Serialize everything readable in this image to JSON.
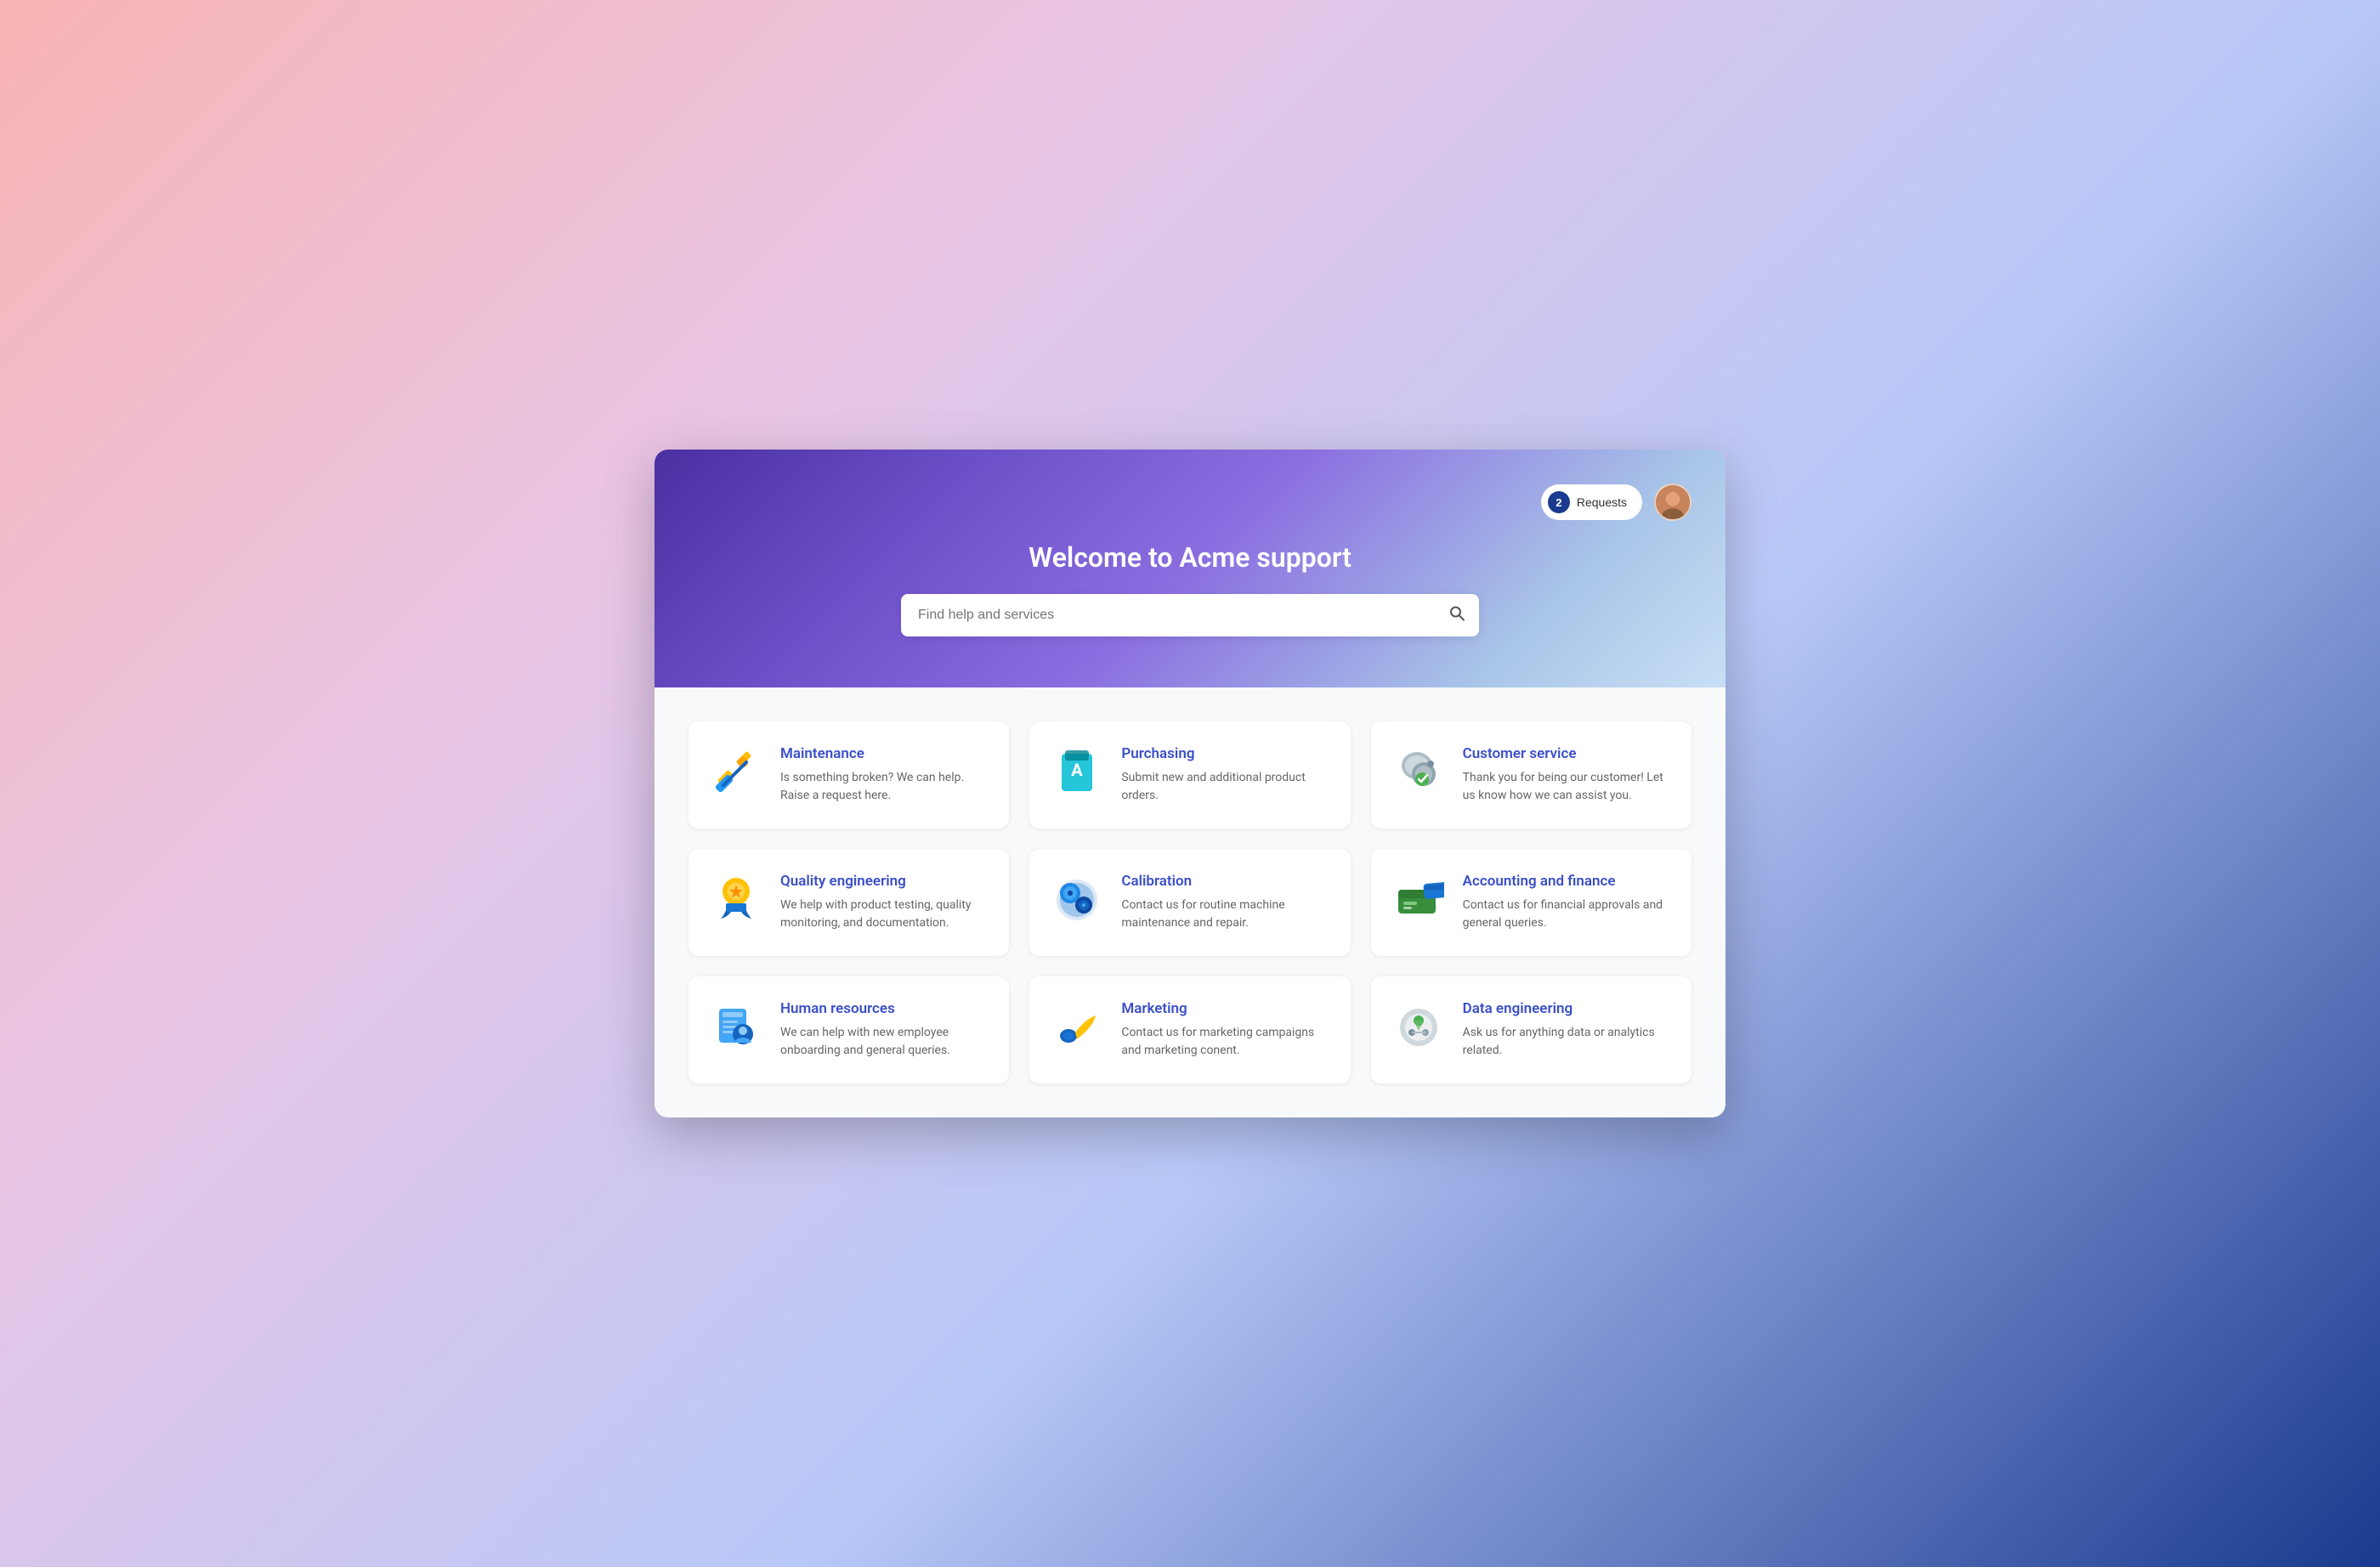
{
  "header": {
    "title": "Welcome to Acme support",
    "requests_label": "Requests",
    "requests_count": "2",
    "search_placeholder": "Find help and services"
  },
  "cards": [
    {
      "id": "maintenance",
      "title": "Maintenance",
      "description": "Is something broken? We can help. Raise a request here.",
      "icon": "maintenance"
    },
    {
      "id": "purchasing",
      "title": "Purchasing",
      "description": "Submit new and additional product orders.",
      "icon": "purchasing"
    },
    {
      "id": "customer-service",
      "title": "Customer service",
      "description": "Thank you for being our customer! Let us know how we can assist you.",
      "icon": "customer-service"
    },
    {
      "id": "quality-engineering",
      "title": "Quality engineering",
      "description": "We help with product testing, quality monitoring, and documentation.",
      "icon": "quality"
    },
    {
      "id": "calibration",
      "title": "Calibration",
      "description": "Contact us for routine machine maintenance and repair.",
      "icon": "calibration"
    },
    {
      "id": "accounting-finance",
      "title": "Accounting and finance",
      "description": "Contact us for financial approvals and general queries.",
      "icon": "accounting"
    },
    {
      "id": "human-resources",
      "title": "Human resources",
      "description": "We can help with new employee onboarding and general queries.",
      "icon": "hr"
    },
    {
      "id": "marketing",
      "title": "Marketing",
      "description": "Contact us for marketing campaigns and marketing conent.",
      "icon": "marketing"
    },
    {
      "id": "data-engineering",
      "title": "Data engineering",
      "description": "Ask us for anything data or analytics related.",
      "icon": "data"
    }
  ]
}
